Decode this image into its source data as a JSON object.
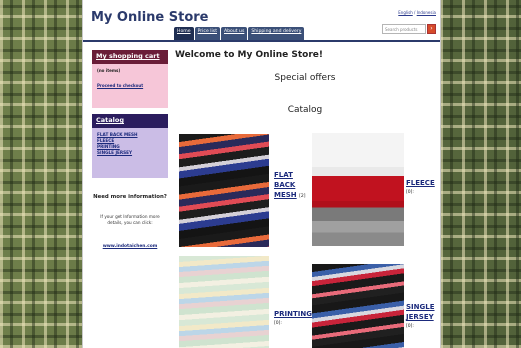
{
  "header": {
    "title": "My Online Store",
    "lang_links": [
      "English",
      "Indonesia"
    ],
    "lang_separator": "/",
    "search_placeholder": "Search products",
    "search_button_icon": "search-icon"
  },
  "nav": {
    "tabs": [
      {
        "label": "Home",
        "active": true
      },
      {
        "label": "Price list",
        "active": false
      },
      {
        "label": "About us",
        "active": false
      },
      {
        "label": "Shipping and delivery",
        "active": false
      }
    ]
  },
  "sidebar": {
    "cart": {
      "title": "My shopping cart",
      "status": "(no items)",
      "checkout_label": "Proceed to checkout"
    },
    "catalog": {
      "title": "Catalog",
      "items": [
        "FLAT BACK MESH",
        "FLEECE",
        "PRINTING",
        "SINGLE JERSEY"
      ]
    },
    "info": {
      "title": "Need more information?",
      "text": "If your get Information more details, you can click:",
      "link": "www.indotaichen.com"
    }
  },
  "main": {
    "welcome": "Welcome to My Online Store!",
    "special_offers": "Special offers",
    "catalog_heading": "Catalog",
    "products": [
      {
        "name_lines": [
          "FLAT",
          "BACK",
          "MESH"
        ],
        "count": "[2]"
      },
      {
        "name_lines": [
          "FLEECE"
        ],
        "count": "[0]:"
      },
      {
        "name_lines": [
          "PRINTING"
        ],
        "count": "[0]:"
      },
      {
        "name_lines": [
          "SINGLE",
          "JERSEY"
        ],
        "count": "[0]:"
      }
    ]
  },
  "colors": {
    "title": "#2b3a6b",
    "cart_header": "#6a1d38",
    "cart_body": "#f6c6d8",
    "catalog_header": "#2b1d5e",
    "catalog_body": "#cbbde6",
    "link": "#1b2a7c",
    "search_button": "#d64a2a"
  }
}
